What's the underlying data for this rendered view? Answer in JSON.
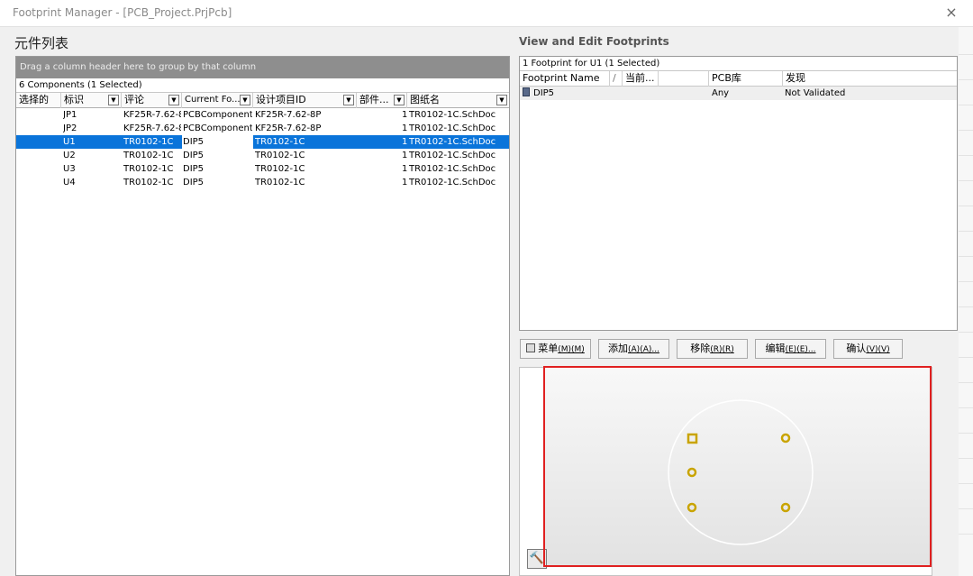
{
  "window": {
    "title": "Footprint Manager - [PCB_Project.PrjPcb]",
    "close_icon": "×"
  },
  "left": {
    "section_title": "元件列表",
    "group_hint": "Drag a column header here to group by that column",
    "count_text": "6 Components (1 Selected)",
    "columns": [
      "选择的",
      "标识",
      "评论",
      "Current Fo...",
      "设计项目ID",
      "部件...",
      "图纸名"
    ],
    "rows": [
      {
        "designator": "JP1",
        "comment": "KF25R-7.62-8",
        "current_footprint": "PCBComponent_",
        "design_id": "KF25R-7.62-8P",
        "part": "1",
        "sheet": "TR0102-1C.SchDoc"
      },
      {
        "designator": "JP2",
        "comment": "KF25R-7.62-8",
        "current_footprint": "PCBComponent_",
        "design_id": "KF25R-7.62-8P",
        "part": "1",
        "sheet": "TR0102-1C.SchDoc"
      },
      {
        "designator": "U1",
        "comment": "TR0102-1C",
        "current_footprint": "DIP5",
        "design_id": "TR0102-1C",
        "part": "1",
        "sheet": "TR0102-1C.SchDoc"
      },
      {
        "designator": "U2",
        "comment": "TR0102-1C",
        "current_footprint": "DIP5",
        "design_id": "TR0102-1C",
        "part": "1",
        "sheet": "TR0102-1C.SchDoc"
      },
      {
        "designator": "U3",
        "comment": "TR0102-1C",
        "current_footprint": "DIP5",
        "design_id": "TR0102-1C",
        "part": "1",
        "sheet": "TR0102-1C.SchDoc"
      },
      {
        "designator": "U4",
        "comment": "TR0102-1C",
        "current_footprint": "DIP5",
        "design_id": "TR0102-1C",
        "part": "1",
        "sheet": "TR0102-1C.SchDoc"
      }
    ],
    "selected_row": 2
  },
  "right": {
    "section_title": "View and Edit Footprints",
    "count_text": "1 Footprint for U1 (1 Selected)",
    "columns": [
      "Footprint Name",
      "/",
      "当前...",
      "PCB库",
      "发现"
    ],
    "rows": [
      {
        "name": "DIP5",
        "library": "Any",
        "status": "Not Validated"
      }
    ],
    "buttons": {
      "menu": {
        "label": "菜单",
        "shortcut": "(M)",
        "accel": "(M)"
      },
      "add": {
        "label": "添加",
        "shortcut": "(A)",
        "accel": "(A)..."
      },
      "remove": {
        "label": "移除",
        "shortcut": "(R)",
        "accel": "(R)"
      },
      "edit": {
        "label": "编辑",
        "shortcut": "(E)",
        "accel": "(E)..."
      },
      "confirm": {
        "label": "确认",
        "shortcut": "(V)",
        "accel": "(V)"
      }
    },
    "preview": {
      "pad_color": "#c9a400",
      "outline_color": "#ffffff",
      "tool_icon": "hammer-icon"
    }
  },
  "colors": {
    "selection": "#0a74da",
    "highlight_box": "#e02020"
  }
}
